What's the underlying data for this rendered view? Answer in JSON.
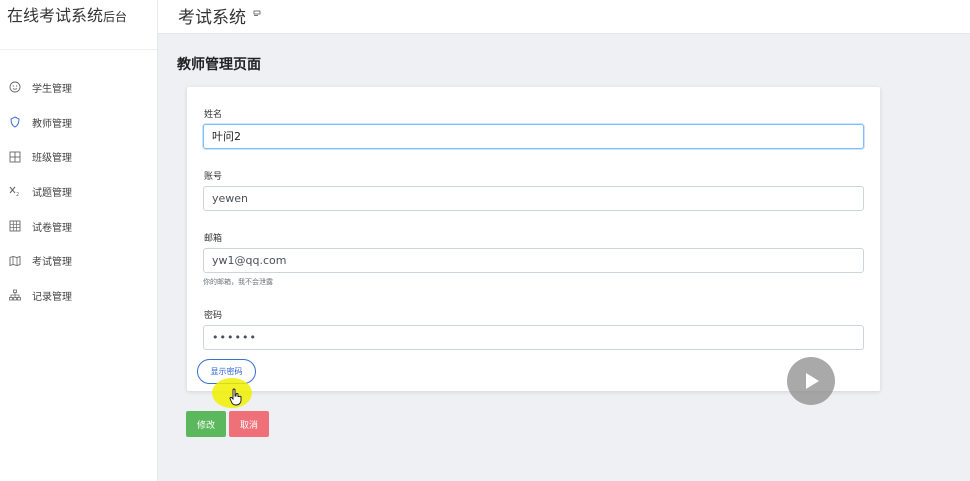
{
  "brand": {
    "title": "在线考试系统",
    "subtitle": "后台"
  },
  "topbar": {
    "title": "考试系统",
    "flag_icon": "flag-icon"
  },
  "sidebar": {
    "items": [
      {
        "label": "学生管理",
        "icon": "smile-icon"
      },
      {
        "label": "教师管理",
        "icon": "shield-icon"
      },
      {
        "label": "班级管理",
        "icon": "grid-icon"
      },
      {
        "label": "试题管理",
        "icon": "subscript-icon"
      },
      {
        "label": "试卷管理",
        "icon": "table-icon"
      },
      {
        "label": "考试管理",
        "icon": "map-icon"
      },
      {
        "label": "记录管理",
        "icon": "sitemap-icon"
      }
    ]
  },
  "page": {
    "title": "教师管理页面"
  },
  "form": {
    "name": {
      "label": "姓名",
      "value": "叶问2"
    },
    "account": {
      "label": "账号",
      "value": "yewen"
    },
    "email": {
      "label": "邮箱",
      "value": "yw1@qq.com",
      "help": "你的邮箱，我不会泄露"
    },
    "password": {
      "label": "密码",
      "value": "••••••"
    },
    "show_password_label": "显示密码"
  },
  "actions": {
    "save_label": "修改",
    "cancel_label": "取消"
  },
  "colors": {
    "save": "#5cb85c",
    "cancel": "#f0707a",
    "accent": "#3c6fd6",
    "sidebar_bg": "#ffffff",
    "page_bg": "#eef0f4"
  }
}
